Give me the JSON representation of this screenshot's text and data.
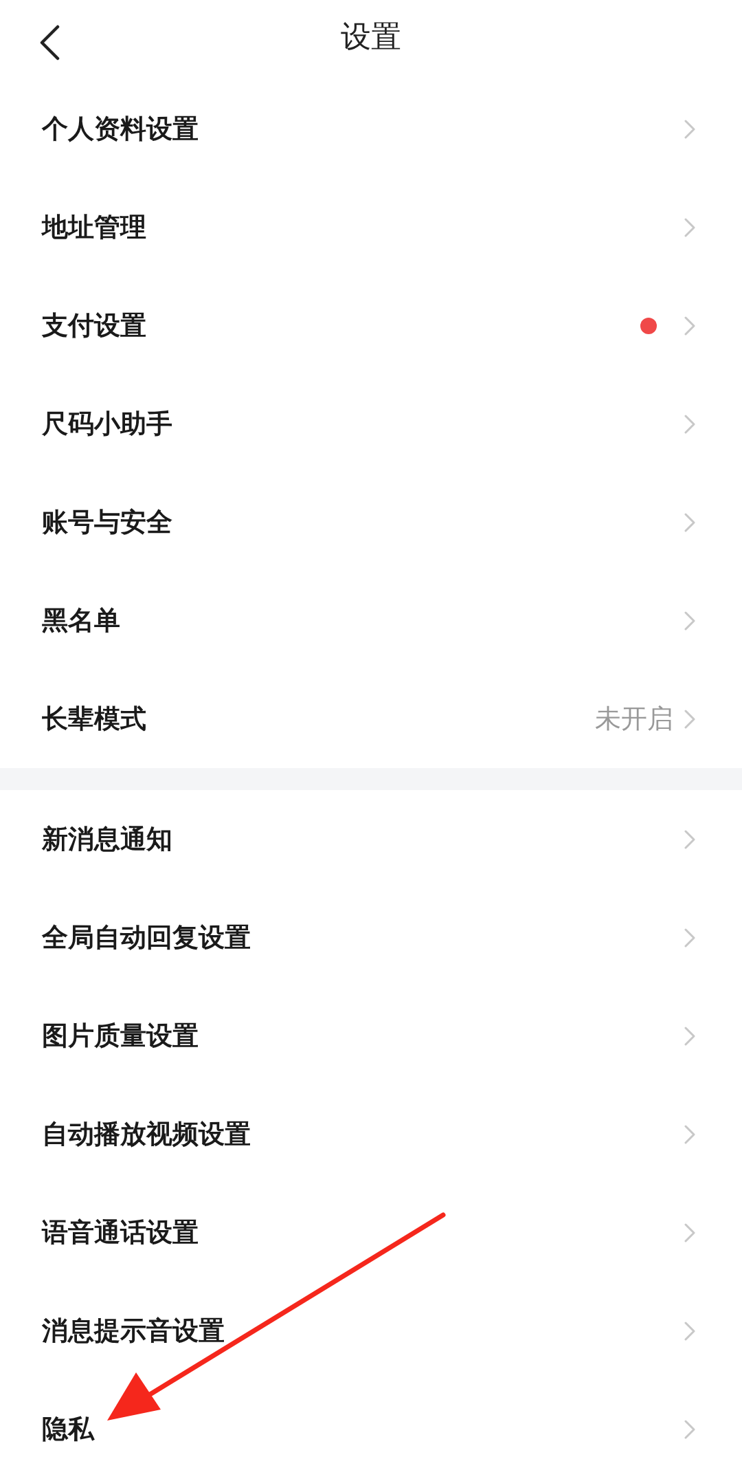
{
  "header": {
    "title": "设置"
  },
  "groups": [
    {
      "items": [
        {
          "label": "个人资料设置",
          "dot": false
        },
        {
          "label": "地址管理",
          "dot": false
        },
        {
          "label": "支付设置",
          "dot": true
        },
        {
          "label": "尺码小助手",
          "dot": false
        },
        {
          "label": "账号与安全",
          "dot": false
        },
        {
          "label": "黑名单",
          "dot": false
        },
        {
          "label": "长辈模式",
          "dot": false,
          "value": "未开启"
        }
      ]
    },
    {
      "items": [
        {
          "label": "新消息通知",
          "dot": false
        },
        {
          "label": "全局自动回复设置",
          "dot": false
        },
        {
          "label": "图片质量设置",
          "dot": false
        },
        {
          "label": "自动播放视频设置",
          "dot": false
        },
        {
          "label": "语音通话设置",
          "dot": false
        },
        {
          "label": "消息提示音设置",
          "dot": false
        },
        {
          "label": "隐私",
          "dot": false
        }
      ]
    }
  ]
}
